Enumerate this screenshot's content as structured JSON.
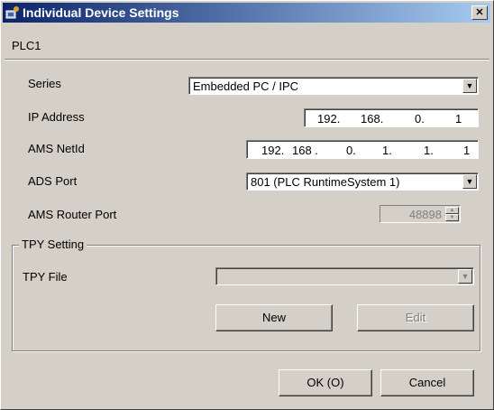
{
  "window": {
    "title": "Individual Device Settings",
    "close_label": "✕"
  },
  "plc_label": "PLC1",
  "fields": {
    "series": {
      "label": "Series",
      "value": "Embedded PC / IPC"
    },
    "ip_address": {
      "label": "IP Address",
      "segments": [
        "192.",
        "168.",
        "0.",
        "1"
      ]
    },
    "ams_netid": {
      "label": "AMS NetId",
      "segments": [
        "192.",
        "168 .",
        "0.",
        "1.",
        "1.",
        "1"
      ]
    },
    "ads_port": {
      "label": "ADS Port",
      "value": "801 (PLC RuntimeSystem 1)"
    },
    "ams_router_port": {
      "label": "AMS Router Port",
      "value": "48898"
    }
  },
  "tpy_group": {
    "title": "TPY Setting",
    "file_label": "TPY File",
    "file_value": "",
    "new_label": "New",
    "edit_label": "Edit"
  },
  "buttons": {
    "ok_label": "OK (O)",
    "cancel_label": "Cancel"
  },
  "icons": {
    "title": "app-icon",
    "dropdown": "chevron-down-icon"
  }
}
